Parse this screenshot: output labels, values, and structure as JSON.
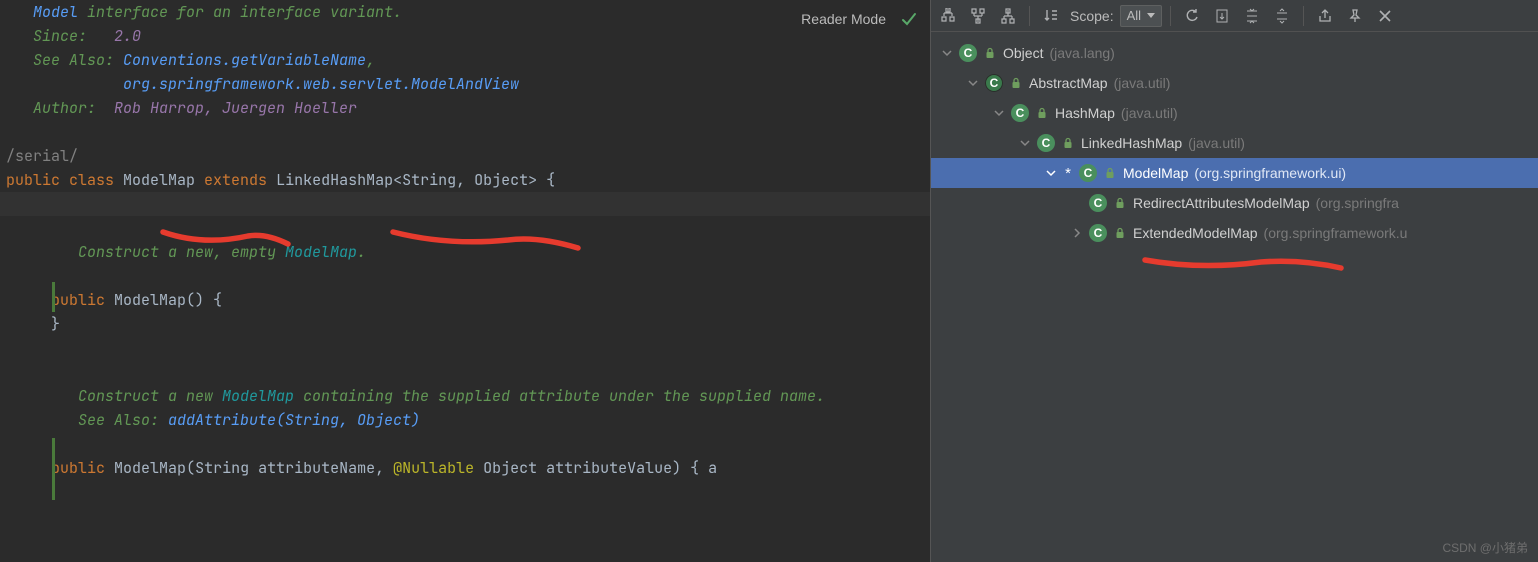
{
  "editor": {
    "reader_mode": "Reader Mode",
    "doc_top_prefix": "Model",
    "doc_top_rest": " interface for an interface variant.",
    "since_label": "Since:",
    "since_value": "2.0",
    "see_also_label": "See Also:",
    "see_also_1": "Conventions.getVariableName",
    "see_also_2": "org.springframework.web.servlet.ModelAndView",
    "author_label": "Author:",
    "author_value": "Rob Harrop, Juergen Hoeller",
    "serial": "/serial/",
    "cls_public": "public ",
    "cls_class": "class ",
    "cls_name": "ModelMap",
    "cls_extends": " extends ",
    "cls_super": "LinkedHashMap",
    "cls_lt": "<",
    "cls_t1": "String",
    "cls_comma": ", ",
    "cls_t2": "Object",
    "cls_gt_brace": "> {",
    "ctor1_doc_a": "Construct a new, empty ",
    "ctor1_doc_b": "ModelMap",
    "ctor1_doc_c": ".",
    "ctor1_sig_public": "public ",
    "ctor1_sig_name": "ModelMap",
    "ctor1_sig_rest": "() {",
    "ctor1_close": "}",
    "ctor2_doc_a": "Construct a new ",
    "ctor2_doc_b": "ModelMap",
    "ctor2_doc_c": " containing the supplied attribute under the supplied name.",
    "ctor2_see_label": "See Also:",
    "ctor2_see_link": "addAttribute(String, Object)",
    "ctor2_public": "public ",
    "ctor2_name": "ModelMap",
    "ctor2_p_open": "(",
    "ctor2_p1_type": "String",
    "ctor2_p1_name": " attributeName",
    "ctor2_p_comma": ", ",
    "ctor2_ann": "@Nullable",
    "ctor2_p2_type": " Object",
    "ctor2_p2_name": " attributeValue",
    "ctor2_p_close_brace": ") { ",
    "ctor2_tail": "a"
  },
  "hierarchy": {
    "scope_label": "Scope:",
    "scope_value": "All",
    "nodes": [
      {
        "name": "Object",
        "pkg": "(java.lang)",
        "depth": 0,
        "arrow": true,
        "selected": false,
        "badge": "C",
        "variant": false,
        "star": false
      },
      {
        "name": "AbstractMap",
        "pkg": "(java.util)",
        "depth": 1,
        "arrow": true,
        "selected": false,
        "badge": "C",
        "variant": true,
        "star": false
      },
      {
        "name": "HashMap",
        "pkg": "(java.util)",
        "depth": 2,
        "arrow": true,
        "selected": false,
        "badge": "C",
        "variant": false,
        "star": false
      },
      {
        "name": "LinkedHashMap",
        "pkg": "(java.util)",
        "depth": 3,
        "arrow": true,
        "selected": false,
        "badge": "C",
        "variant": false,
        "star": false
      },
      {
        "name": "ModelMap",
        "pkg": "(org.springframework.ui)",
        "depth": 4,
        "arrow": true,
        "selected": true,
        "badge": "C",
        "variant": false,
        "star": true
      },
      {
        "name": "RedirectAttributesModelMap",
        "pkg": "(org.springfra",
        "depth": 5,
        "arrow": false,
        "selected": false,
        "badge": "C",
        "variant": false,
        "star": false,
        "noarrow": true
      },
      {
        "name": "ExtendedModelMap",
        "pkg": "(org.springframework.u",
        "depth": 5,
        "arrow": true,
        "selected": false,
        "badge": "C",
        "variant": false,
        "star": false,
        "arrowdir": "right"
      }
    ]
  },
  "watermark": "CSDN @小猪弟"
}
